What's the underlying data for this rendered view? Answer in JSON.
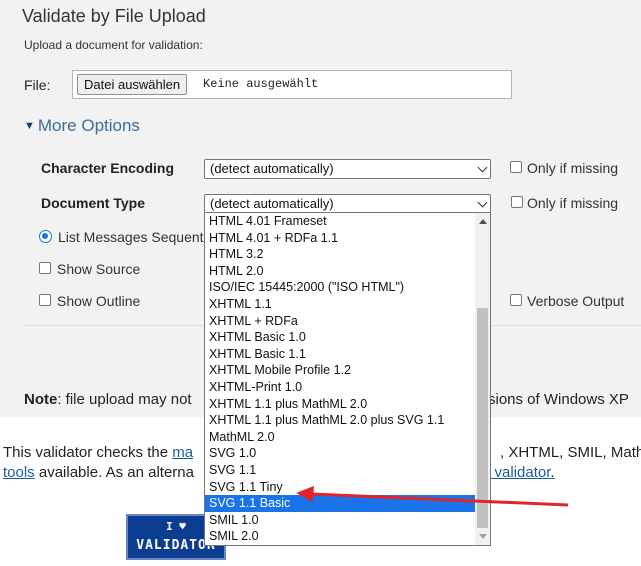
{
  "header": {
    "title": "Validate by File Upload",
    "subtitle": "Upload a document for validation:"
  },
  "file": {
    "label": "File:",
    "button_label": "Datei auswählen",
    "status": "Keine ausgewählt"
  },
  "more_options": {
    "label": "More Options"
  },
  "options": {
    "encoding_label": "Character Encoding",
    "encoding_value": "(detect automatically)",
    "encoding_only_missing": "Only if missing",
    "doctype_label": "Document Type",
    "doctype_value": "(detect automatically)",
    "doctype_only_missing": "Only if missing",
    "list_messages": "List Messages Sequent",
    "show_source": "Show Source",
    "show_outline": "Show Outline",
    "verbose_output": "Verbose Output"
  },
  "dropdown": {
    "options": [
      "HTML 4.01 Frameset",
      "HTML 4.01 + RDFa 1.1",
      "HTML 3.2",
      "HTML 2.0",
      "ISO/IEC 15445:2000 (\"ISO HTML\")",
      "XHTML 1.1",
      "XHTML + RDFa",
      "XHTML Basic 1.0",
      "XHTML Basic 1.1",
      "XHTML Mobile Profile 1.2",
      "XHTML-Print 1.0",
      "XHTML 1.1 plus MathML 2.0",
      "XHTML 1.1 plus MathML 2.0 plus SVG 1.1",
      "MathML 2.0",
      "SVG 1.0",
      "SVG 1.1",
      "SVG 1.1 Tiny",
      "SVG 1.1 Basic",
      "SMIL 1.0",
      "SMIL 2.0"
    ],
    "selected": "SVG 1.1 Basic"
  },
  "note": {
    "bold": "Note",
    "text": ": file upload may not",
    "tail": "sions of Windows XP"
  },
  "footer": {
    "p1_start": "This validator checks the ",
    "p1_link": "ma",
    "p1_tail": ", XHTML, SMIL, Math",
    "p2_link": "tools",
    "p2_text": " available. As an alterna",
    "p2_tail_link": "l validator",
    "p2_end": "."
  },
  "badge": {
    "top": "I ♥",
    "bottom": "VALIDATOR"
  },
  "colors": {
    "panel_bg": "#f2f2f2",
    "accent": "#1a73e8",
    "link": "#1a5c9a",
    "more_options": "#3b6d9c",
    "arrow": "#e0242a",
    "badge_bg": "#0b3d91"
  }
}
